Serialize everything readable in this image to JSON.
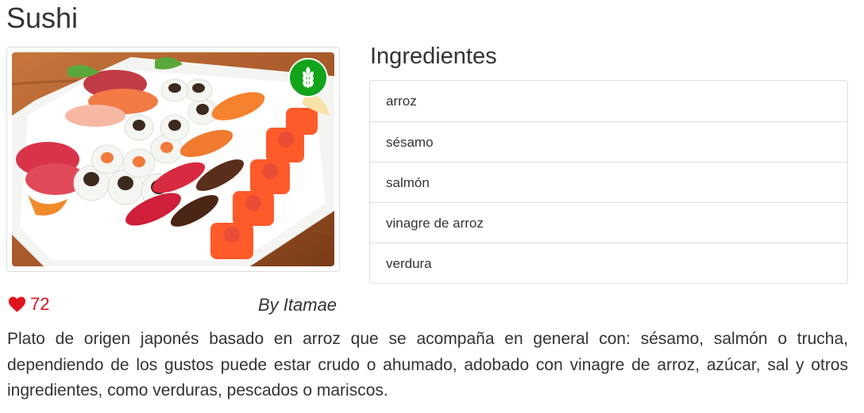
{
  "recipe": {
    "title": "Sushi",
    "image_alt": "Sushi",
    "badge_icon": "wheat-icon",
    "badge_color": "#12a41a",
    "likes": "72",
    "author": "By Itamae",
    "description": "Plato de origen japonés basado en arroz que se acompaña en general con: sésamo, salmón o trucha, dependiendo de los gustos puede estar crudo o ahumado, adobado con vinagre de arroz, azúcar, sal y otros ingredientes, como verduras, pescados o mariscos."
  },
  "ingredients": {
    "heading": "Ingredientes",
    "items": [
      "arroz",
      "sésamo",
      "salmón",
      "vinagre de arroz",
      "verdura"
    ]
  },
  "colors": {
    "like": "#e0141e",
    "text": "#333333",
    "border": "#dddddd"
  }
}
